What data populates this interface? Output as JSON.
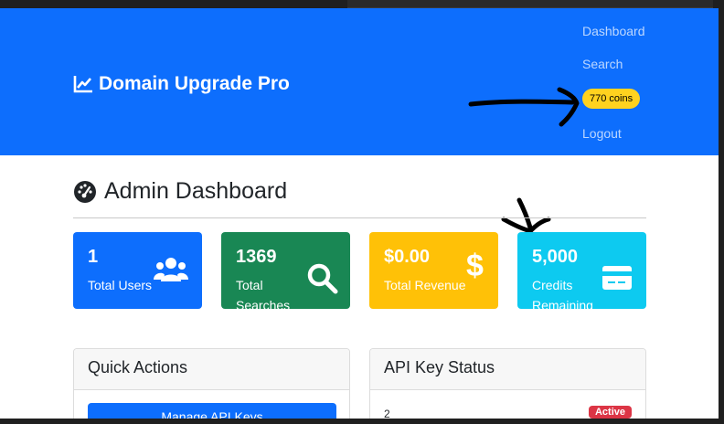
{
  "brand": {
    "title": "Domain Upgrade Pro",
    "icon": "chart-line-icon"
  },
  "nav": {
    "dashboard": "Dashboard",
    "search": "Search",
    "coins": "770 coins",
    "logout": "Logout"
  },
  "page": {
    "title": "Admin Dashboard",
    "icon": "tachometer-icon"
  },
  "stats": [
    {
      "value": "1",
      "label_line1": "Total Users",
      "label_line2": "",
      "icon": "users-icon",
      "color": "#0d6efd"
    },
    {
      "value": "1369",
      "label_line1": "Total",
      "label_line2": "Searches",
      "icon": "search-icon",
      "color": "#198754"
    },
    {
      "value": "$0.00",
      "label_line1": "Total Revenue",
      "label_line2": "",
      "icon": "dollar-icon",
      "color": "#ffc107"
    },
    {
      "value": "5,000",
      "label_line1": "Credits",
      "label_line2": "Remaining",
      "icon": "credit-card-icon",
      "color": "#0dcaf0"
    }
  ],
  "quick_actions": {
    "title": "Quick Actions",
    "button_label": "Manage API Keys"
  },
  "api_key_status": {
    "title": "API Key Status",
    "row_number": "2",
    "status_badge": "Active"
  }
}
